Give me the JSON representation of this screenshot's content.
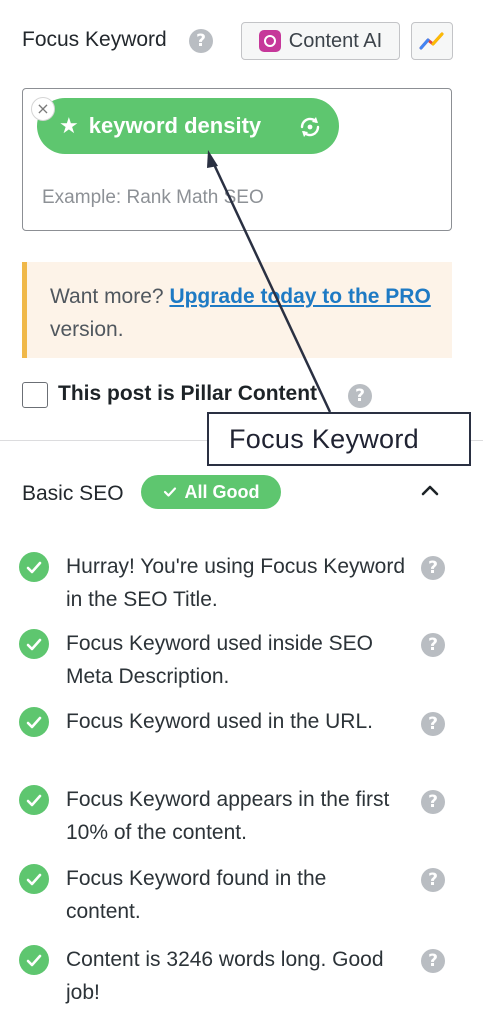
{
  "focus_keyword": {
    "label": "Focus Keyword",
    "help_icon": "question-circle-icon",
    "content_ai_label": "Content AI",
    "trends_icon": "trends-chart-icon",
    "keyword": "keyword density",
    "placeholder": "Example: Rank Math SEO"
  },
  "notice": {
    "prefix": "Want more? ",
    "link_text": "Upgrade today to the PRO",
    "suffix": " version."
  },
  "pillar": {
    "label": "This post is Pillar Content",
    "checked": false
  },
  "annotation": {
    "label": "Focus Keyword"
  },
  "basic_seo": {
    "title": "Basic SEO",
    "badge": "All Good",
    "items": [
      {
        "text": "Hurray! You're using Focus Keyword in the SEO Title."
      },
      {
        "text": "Focus Keyword used inside SEO Meta Description."
      },
      {
        "text": "Focus Keyword used in the URL."
      },
      {
        "text": "Focus Keyword appears in the first 10% of the content."
      },
      {
        "text": "Focus Keyword found in the content."
      },
      {
        "text": "Content is 3246 words long. Good job!"
      }
    ]
  },
  "colors": {
    "success": "#5ec66f",
    "link": "#1e7ac4",
    "notice_border": "#f0b849",
    "notice_bg": "#fdf3e8"
  }
}
